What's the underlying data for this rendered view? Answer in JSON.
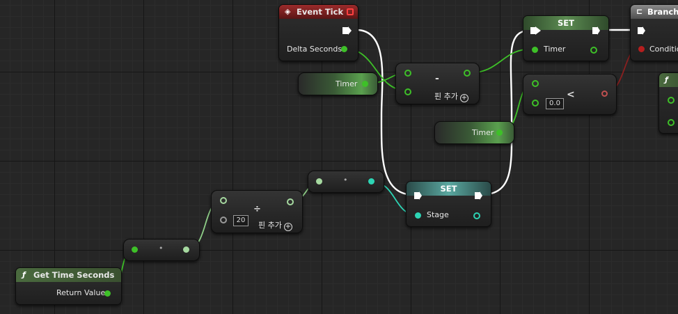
{
  "graph": {
    "event_tick": {
      "title": "Event Tick",
      "output_label": "Delta Seconds"
    },
    "timer_var_1": {
      "label": "Timer"
    },
    "timer_var_2": {
      "label": "Timer"
    },
    "subtract": {
      "operator": "-",
      "add_pin_label": "핀 추가"
    },
    "set_timer": {
      "title": "SET",
      "field_label": "Timer"
    },
    "less_than": {
      "operator": "<",
      "value": "0.0"
    },
    "branch": {
      "title": "Branch",
      "condition_label": "Conditio"
    },
    "get_time_seconds": {
      "title": "Get Time Seconds",
      "output_label": "Return Value"
    },
    "reroute_1": {
      "label": "•"
    },
    "divide": {
      "operator": "÷",
      "value": "20",
      "add_pin_label": "핀 추가"
    },
    "reroute_2": {
      "label": "•"
    },
    "set_stage": {
      "title": "SET",
      "field_label": "Stage"
    },
    "partial_function": {
      "icon": "ƒ"
    }
  },
  "icons": {
    "event": "diamond-icon",
    "function": "function-icon",
    "branch": "branch-icon",
    "add": "plus-circle-icon",
    "delegate": "delegate-icon"
  },
  "colors": {
    "float_pin": "#3ec028",
    "int_pin": "#2dd4b4",
    "bool_pin": "#b51e1e",
    "exec_wire": "#ffffff",
    "event_header": "#9b2b2b",
    "function_header": "#4a6a3e",
    "branch_header": "#8a8a8a"
  }
}
